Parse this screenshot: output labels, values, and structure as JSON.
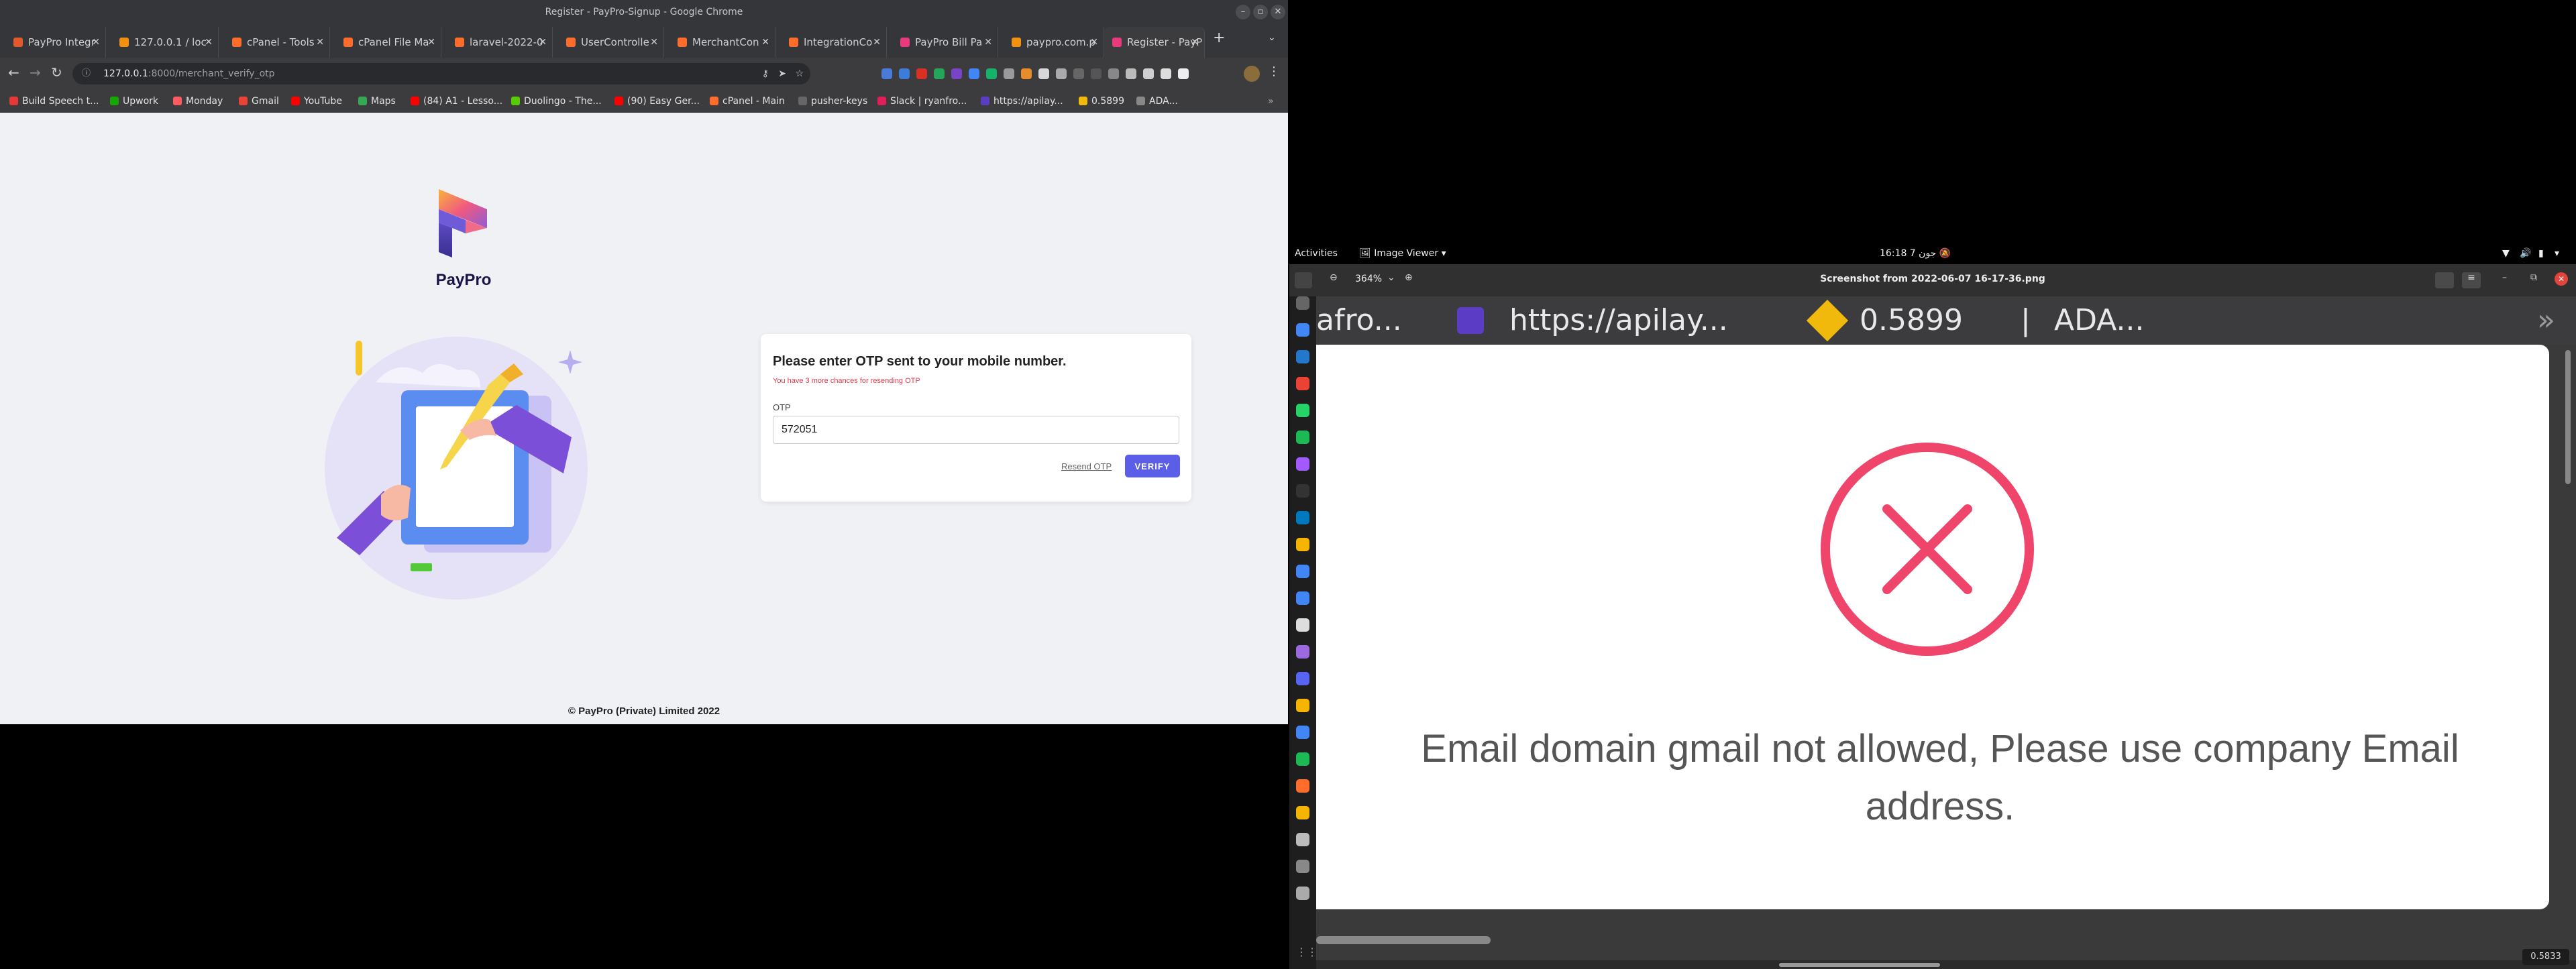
{
  "chrome": {
    "title": "Register - PayPro-Signup - Google Chrome",
    "tabs": [
      {
        "label": "PayPro Integr"
      },
      {
        "label": "127.0.0.1 / loc"
      },
      {
        "label": "cPanel - Tools"
      },
      {
        "label": "cPanel File Ma"
      },
      {
        "label": "laravel-2022-0"
      },
      {
        "label": "UserControlle"
      },
      {
        "label": "MerchantCon"
      },
      {
        "label": "IntegrationCo"
      },
      {
        "label": "PayPro Bill Pa"
      },
      {
        "label": "paypro.com.p"
      },
      {
        "label": "Register - PayP"
      }
    ],
    "new_tab": "+",
    "url_host": "127.0.0.1",
    "url_path": ":8000/merchant_verify_otp",
    "bookmarks": [
      {
        "label": "Build Speech t...",
        "color": "#e53935"
      },
      {
        "label": "Upwork",
        "color": "#14a800"
      },
      {
        "label": "Monday",
        "color": "#ff5a5f"
      },
      {
        "label": "Gmail",
        "color": "#ea4335"
      },
      {
        "label": "YouTube",
        "color": "#ff0000"
      },
      {
        "label": "Maps",
        "color": "#34a853"
      },
      {
        "label": "(84) A1 - Lesso...",
        "color": "#ff0000"
      },
      {
        "label": "Duolingo - The...",
        "color": "#58cc02"
      },
      {
        "label": "(90) Easy Ger...",
        "color": "#ff0000"
      },
      {
        "label": "cPanel - Main",
        "color": "#ff6c2c"
      },
      {
        "label": "pusher-keys",
        "color": "#666666"
      },
      {
        "label": "Slack | ryanfro...",
        "color": "#e01e5a"
      },
      {
        "label": "https://apilay...",
        "color": "#5b3cc4"
      },
      {
        "label": "0.5899",
        "color": "#f0b90b"
      },
      {
        "label": "ADA...",
        "color": "#888888"
      }
    ]
  },
  "page": {
    "brand": "PayPro",
    "card": {
      "heading": "Please enter OTP sent to your mobile number.",
      "subtext": "You have 3 more chances for resending OTP",
      "otp_label": "OTP",
      "otp_value": "572051",
      "resend": "Resend OTP",
      "verify": "VERIFY"
    },
    "footer": "© PayPro (Private) Limited 2022"
  },
  "gnome": {
    "activities": "Activities",
    "app_menu": "Image Viewer",
    "clock": "16:18  7 جون"
  },
  "viewer": {
    "zoom": "364%",
    "title": "Screenshot from 2022-06-07 16-17-36.png",
    "shot_top_text": "afro...",
    "shot_top_link": "https://apilay...",
    "shot_top_price": "0.5899",
    "shot_top_sep": "|",
    "shot_top_ada": "ADA...",
    "error_message": "Email domain gmail not allowed, Please use company Email address.",
    "status_value": "0.5833"
  }
}
